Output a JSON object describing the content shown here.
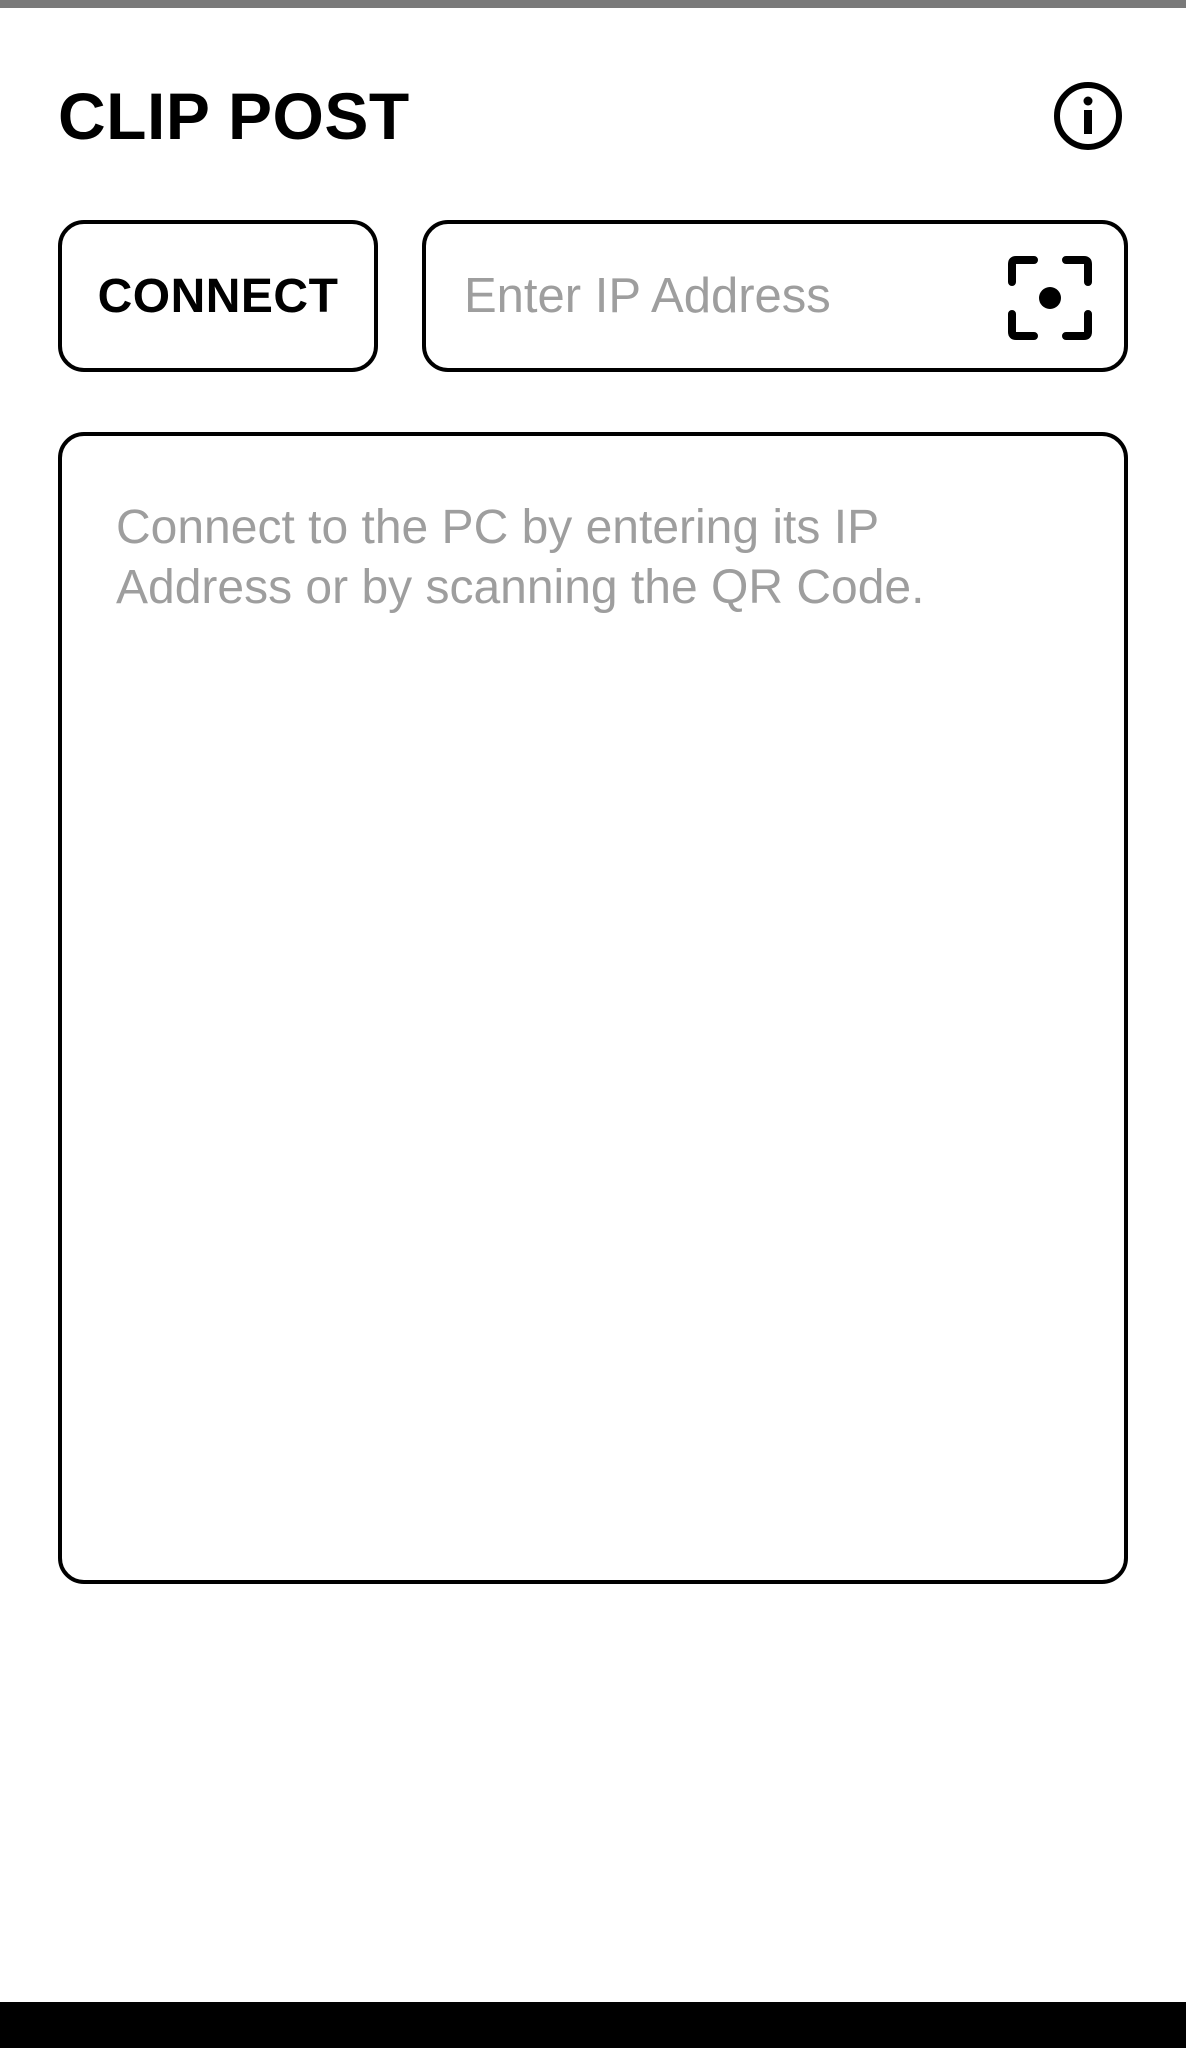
{
  "app": {
    "title": "CLIP POST"
  },
  "header": {
    "info_icon": "info-circle-icon"
  },
  "connection": {
    "connect_label": "CONNECT",
    "ip_input_value": "",
    "ip_input_placeholder": "Enter IP Address",
    "scan_icon": "qr-scan-icon"
  },
  "clipboard": {
    "placeholder_text": "Connect to the PC by entering its IP Address or by scanning the QR Code."
  },
  "colors": {
    "background": "#ffffff",
    "text": "#000000",
    "placeholder": "#9e9e9e",
    "border": "#000000"
  }
}
